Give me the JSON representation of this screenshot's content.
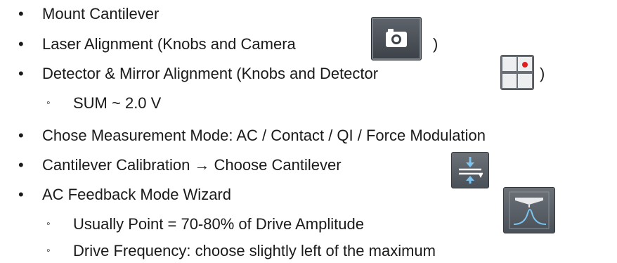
{
  "bullets": [
    {
      "marker": "•",
      "text": "Mount Cantilever"
    },
    {
      "marker": "•",
      "text": "Laser Alignment (Knobs and Camera",
      "suffix": ")",
      "icon": "camera-icon"
    },
    {
      "marker": "•",
      "text": "Detector & Mirror Alignment (Knobs and Detector",
      "suffix": ")",
      "icon": "detector-grid-icon"
    },
    {
      "marker": "◦",
      "text": "SUM ~ 2.0 V"
    },
    {
      "marker": "•",
      "text": "Chose Measurement Mode: AC / Contact / QI / Force Modulation"
    },
    {
      "marker": "•",
      "text": "Cantilever Calibration → Choose Cantilever",
      "icon": "cantilever-calibration-icon"
    },
    {
      "marker": "•",
      "text": "AC Feedback Mode Wizard",
      "icon": "resonance-peak-icon"
    },
    {
      "marker": "◦",
      "text": "Usually Point = 70-80% of Drive Amplitude"
    },
    {
      "marker": "◦",
      "text": "Drive Frequency: choose slightly left of the maximum"
    }
  ],
  "colors": {
    "text": "#1a1a1a",
    "icon_bg": "#5a6067",
    "accent_blue": "#5fb0e8",
    "accent_red": "#e02020"
  }
}
